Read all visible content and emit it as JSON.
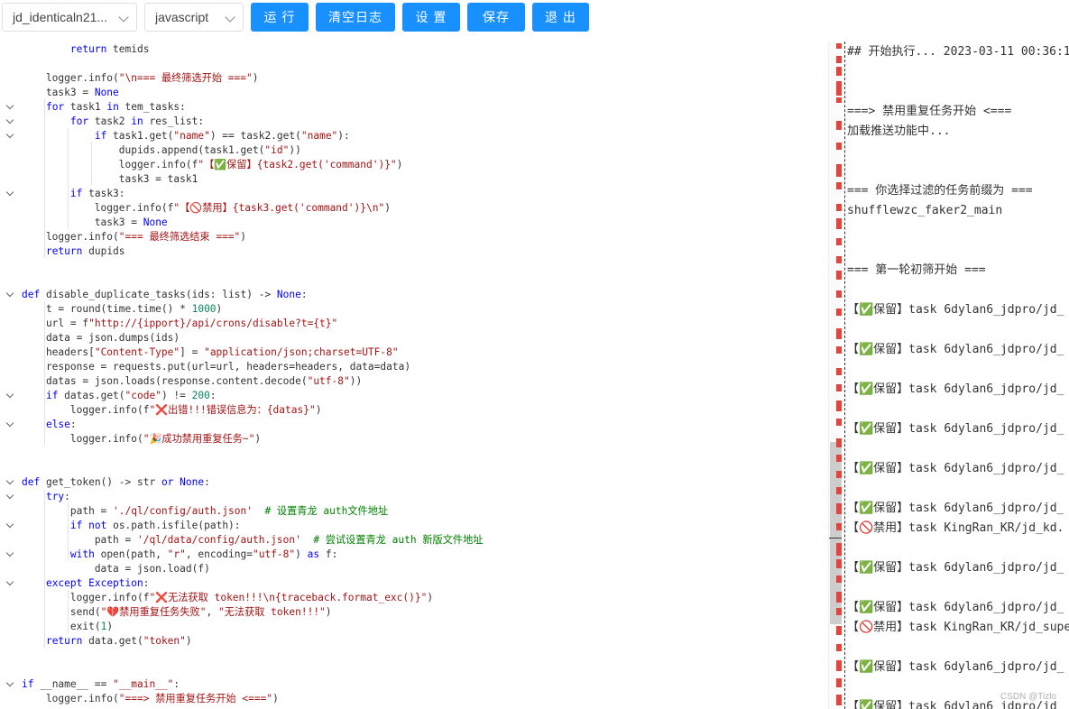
{
  "toolbar": {
    "script_select": "jd_identicaln21...",
    "lang_select": "javascript",
    "run": "运 行",
    "clear_log": "清空日志",
    "settings": "设 置",
    "save": "保存",
    "exit": "退 出"
  },
  "editor": {
    "lines": [
      "        return temids",
      "",
      "    logger.info(\"\\n=== 最终筛选开始 ===\")",
      "    task3 = None",
      "    for task1 in tem_tasks:",
      "        for task2 in res_list:",
      "            if task1.get(\"name\") == task2.get(\"name\"):",
      "                dupids.append(task1.get(\"id\"))",
      "                logger.info(f\"【✅保留】{task2.get('command')}\")",
      "                task3 = task1",
      "        if task3:",
      "            logger.info(f\"【🚫禁用】{task3.get('command')}\\n\")",
      "            task3 = None",
      "    logger.info(\"=== 最终筛选结束 ===\")",
      "    return dupids",
      "",
      "",
      "def disable_duplicate_tasks(ids: list) -> None:",
      "    t = round(time.time() * 1000)",
      "    url = f\"http://{ipport}/api/crons/disable?t={t}\"",
      "    data = json.dumps(ids)",
      "    headers[\"Content-Type\"] = \"application/json;charset=UTF-8\"",
      "    response = requests.put(url=url, headers=headers, data=data)",
      "    datas = json.loads(response.content.decode(\"utf-8\"))",
      "    if datas.get(\"code\") != 200:",
      "        logger.info(f\"❌出错!!!错误信息为：{datas}\")",
      "    else:",
      "        logger.info(\"🎉成功禁用重复任务~\")",
      "",
      "",
      "def get_token() -> str or None:",
      "    try:",
      "        path = './ql/config/auth.json'  # 设置青龙 auth文件地址",
      "        if not os.path.isfile(path):",
      "            path = '/ql/data/config/auth.json'  # 尝试设置青龙 auth 新版文件地址",
      "        with open(path, \"r\", encoding=\"utf-8\") as f:",
      "            data = json.load(f)",
      "    except Exception:",
      "        logger.info(f\"❌无法获取 token!!!\\n{traceback.format_exc()}\")",
      "        send(\"💔禁用重复任务失败\", \"无法获取 token!!!\")",
      "        exit(1)",
      "    return data.get(\"token\")",
      "",
      "",
      "if __name__ == \"__main__\":",
      "    logger.info(\"===> 禁用重复任务开始 <===\")"
    ]
  },
  "log": {
    "lines": [
      "## 开始执行... 2023-03-11 00:36:1",
      "===> 禁用重复任务开始 <===",
      "加载推送功能中...",
      "=== 你选择过滤的任务前缀为 ===",
      "shufflewzc_faker2_main",
      "=== 第一轮初筛开始 ===",
      "【✅保留】task 6dylan6_jdpro/jd_",
      "【✅保留】task 6dylan6_jdpro/jd_",
      "【✅保留】task 6dylan6_jdpro/jd_",
      "【✅保留】task 6dylan6_jdpro/jd_",
      "【✅保留】task 6dylan6_jdpro/jd_",
      "【✅保留】task 6dylan6_jdpro/jd_",
      "【🚫禁用】task KingRan_KR/jd_kd.",
      "【✅保留】task 6dylan6_jdpro/jd_",
      "【✅保留】task 6dylan6_jdpro/jd_",
      "【🚫禁用】task KingRan_KR/jd_supe",
      "【✅保留】task 6dylan6_jdpro/jd_",
      "【✅保留】task 6dylan6_jdpro/jd_"
    ]
  },
  "watermark": "CSDN @Tizlo"
}
